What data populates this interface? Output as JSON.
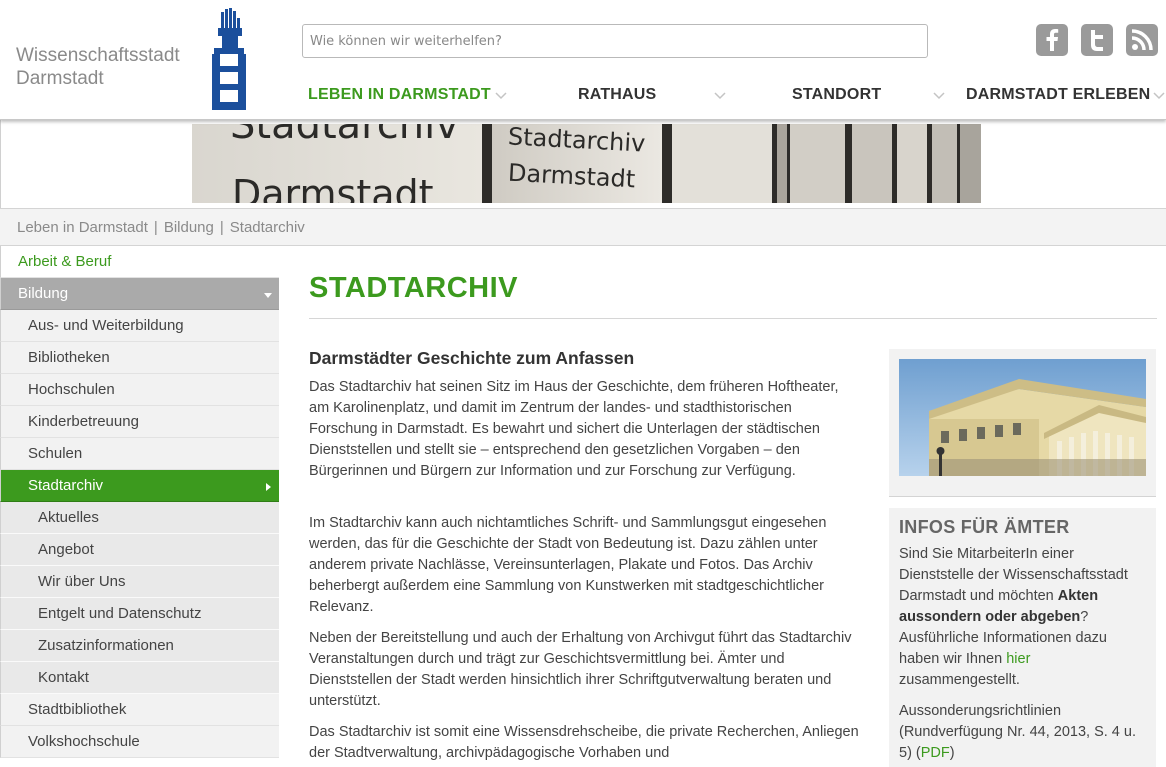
{
  "header": {
    "logo_line1": "Wissenschaftsstadt",
    "logo_line2": "Darmstadt",
    "search_placeholder": "Wie können wir weiterhelfen?",
    "social": [
      {
        "icon": "facebook-icon"
      },
      {
        "icon": "twitter-icon"
      },
      {
        "icon": "rss-icon"
      }
    ],
    "nav": [
      {
        "label": "LEBEN IN DARMSTADT",
        "active": true
      },
      {
        "label": "RATHAUS",
        "active": false
      },
      {
        "label": "STANDORT",
        "active": false
      },
      {
        "label": "DARMSTADT ERLEBEN",
        "active": false
      }
    ]
  },
  "banner": {
    "text_big": "Stadtarchiv",
    "text_big2": "Darmstadt",
    "text_mid": "Stadtarchiv",
    "text_mid2": "Darmstadt"
  },
  "breadcrumb": [
    "Leben in Darmstadt",
    "Bildung",
    "Stadtarchiv"
  ],
  "sidebar": {
    "items": [
      {
        "label": "Arbeit & Beruf",
        "level": 0
      },
      {
        "label": "Bildung",
        "level": 0,
        "open": true
      },
      {
        "label": "Aus- und Weiterbildung",
        "level": 1
      },
      {
        "label": "Bibliotheken",
        "level": 1
      },
      {
        "label": "Hochschulen",
        "level": 1
      },
      {
        "label": "Kinderbetreuung",
        "level": 1
      },
      {
        "label": "Schulen",
        "level": 1
      },
      {
        "label": "Stadtarchiv",
        "level": 1,
        "active": true
      },
      {
        "label": "Aktuelles",
        "level": 2
      },
      {
        "label": "Angebot",
        "level": 2
      },
      {
        "label": "Wir über Uns",
        "level": 2
      },
      {
        "label": "Entgelt und Datenschutz",
        "level": 2
      },
      {
        "label": "Zusatzinformationen",
        "level": 2
      },
      {
        "label": "Kontakt",
        "level": 2
      },
      {
        "label": "Stadtbibliothek",
        "level": 1
      },
      {
        "label": "Volkshochschule",
        "level": 1
      }
    ]
  },
  "main": {
    "title": "STADTARCHIV",
    "subhead": "Darmstädter Geschichte zum Anfassen",
    "paragraphs": [
      "Das Stadtarchiv hat seinen Sitz im Haus der Geschichte, dem früheren Hoftheater, am Karolinenplatz, und damit im Zentrum der landes- und stadthistorischen Forschung in Darmstadt. Es bewahrt und sichert die Unterlagen der städtischen Dienststellen und stellt sie – entsprechend den gesetzlichen Vorgaben – den Bürgerinnen und Bürgern zur Information und zur Forschung zur Verfügung.",
      "Im Stadtarchiv kann auch nichtamtliches Schrift- und Sammlungsgut eingesehen werden, das für die Geschichte der Stadt von Bedeutung ist. Dazu zählen unter anderem private Nachlässe, Vereinsunterlagen, Plakate und Fotos. Das Archiv beherbergt außerdem eine Sammlung von Kunstwerken mit stadtgeschichtlicher Relevanz.",
      "Neben der Bereitstellung und auch der Erhaltung von Archivgut führt das Stadtarchiv Veranstaltungen durch und trägt zur Geschichtsvermittlung bei. Ämter und Dienststellen der Stadt werden hinsichtlich ihrer Schriftgutverwaltung beraten und unterstützt.",
      "Das Stadtarchiv ist somit eine Wissensdrehscheibe, die private Recherchen, Anliegen der Stadtverwaltung, archivpädagogische Vorhaben und"
    ]
  },
  "aside": {
    "info_title": "INFOS FÜR ÄMTER",
    "info_part1": "Sind Sie MitarbeiterIn einer Dienststelle der Wissenschaftsstadt Darmstadt und möchten ",
    "info_bold": "Akten aussondern oder abgeben",
    "info_part2": "? Ausführliche Informationen dazu haben wir Ihnen ",
    "info_link": "hier",
    "info_part3": " zusammengestellt.",
    "guide_text": "Aussonderungsrichtlinien (Rundverfügung Nr. 44, 2013, S. 4 u. 5) (",
    "guide_link": "PDF",
    "guide_end": ")"
  },
  "colors": {
    "accent_green": "#3c9a1e",
    "brand_blue": "#1b4f9c",
    "sidebar_open_grey": "#aaaaaa"
  }
}
